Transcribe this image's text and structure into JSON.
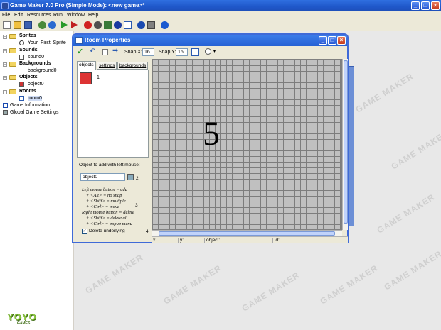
{
  "app": {
    "title": "Game Maker 7.0 Pro (Simple Mode): <new game>*"
  },
  "menu": [
    "File",
    "Edit",
    "Resources",
    "Run",
    "Window",
    "Help"
  ],
  "tree": {
    "sprites": "Sprites",
    "sprite_item": "Your_First_Sprite",
    "sounds": "Sounds",
    "sound_item": "sound0",
    "backgrounds": "Backgrounds",
    "background_item": "background0",
    "objects": "Objects",
    "object_item": "object0",
    "rooms": "Rooms",
    "room_item": "room0",
    "game_info": "Game Information",
    "global_settings": "Global Game Settings"
  },
  "logo": {
    "top": "YOYO",
    "bottom": "GAMES"
  },
  "watermark": "GAME MAKER",
  "room": {
    "title": "Room Properties",
    "snap_x_label": "Snap X:",
    "snap_x": "16",
    "snap_y_label": "Snap Y:",
    "snap_y": "16",
    "tabs": [
      "objects",
      "settings",
      "backgrounds"
    ],
    "object_count": "1",
    "add_label": "Object to add with left mouse:",
    "object_selected": "object0",
    "callout_2": "2",
    "help_lines": [
      "Left mouse button = add",
      "+ <Alt> = no snap",
      "+ <Shift> = multiple",
      "+ <Ctrl> = move",
      "Right mouse button = delete",
      "+ <Shift> = delete all",
      "+ <Ctrl> = popup menu"
    ],
    "callout_3": "3",
    "delete_underlying": "Delete underlying",
    "delete_underlying_checked": true,
    "callout_4": "4",
    "big_label": "5",
    "status": {
      "x": "x:",
      "y": "y:",
      "object": "object:",
      "id": "id:"
    }
  },
  "colors": {
    "titlebar": "#2561d4",
    "grid": "#c0c0c0",
    "logo": "#8bc53f"
  }
}
